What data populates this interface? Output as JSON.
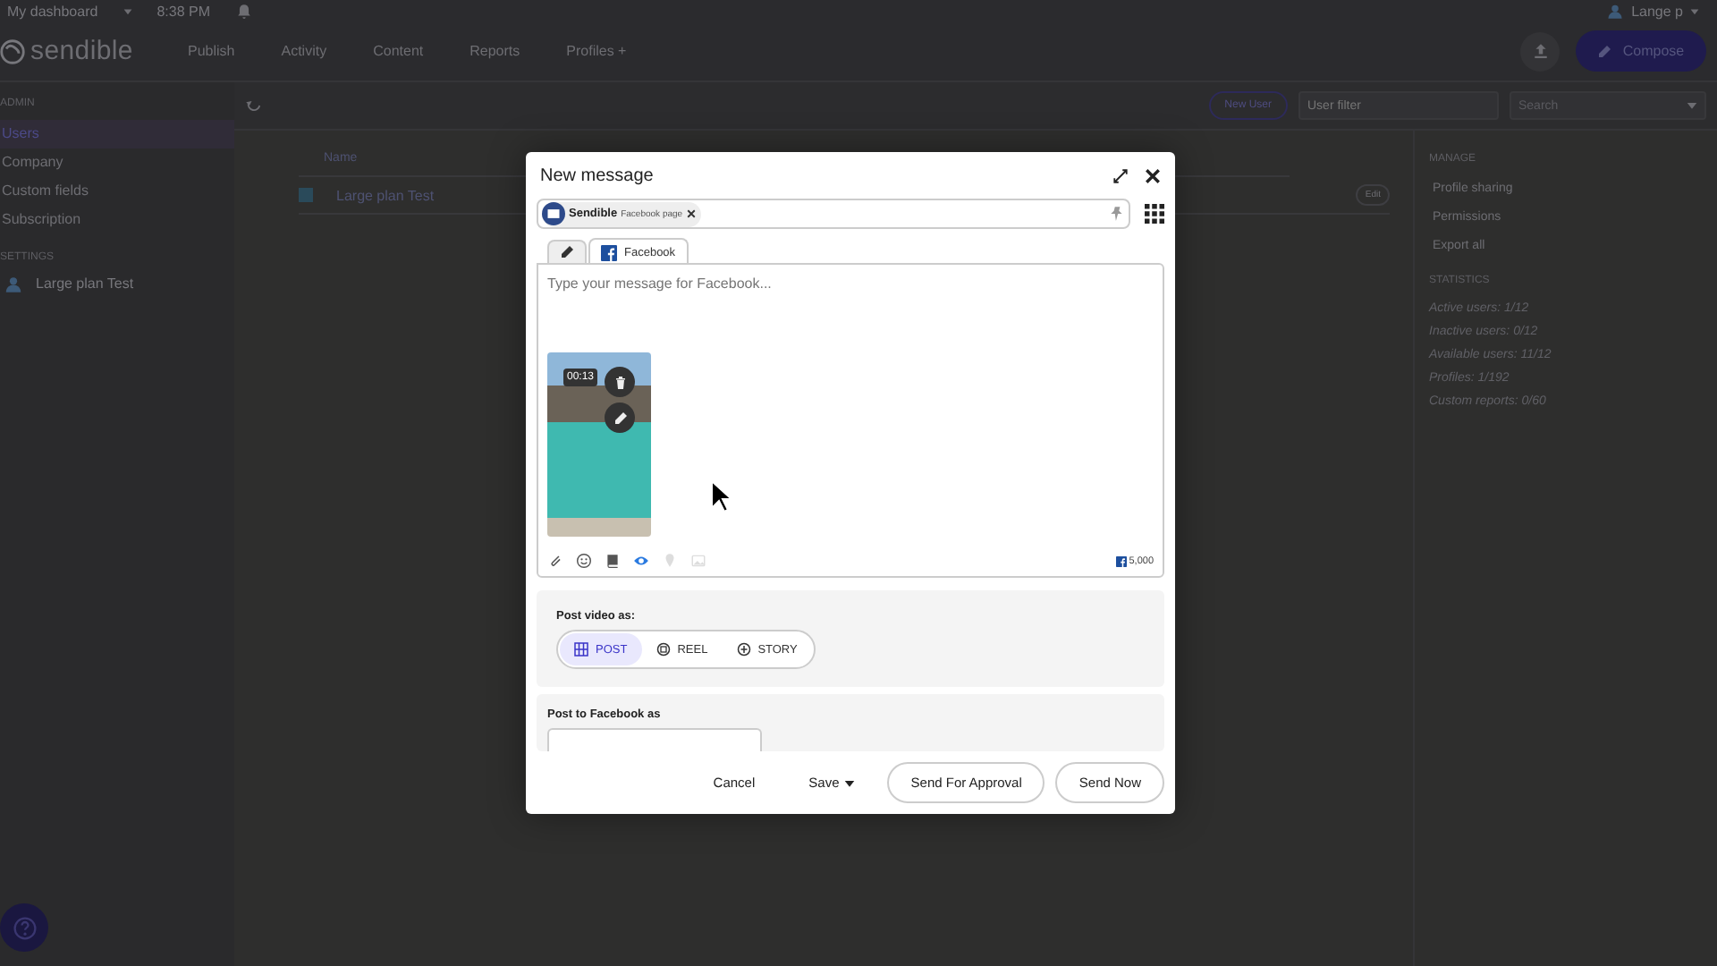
{
  "top_bar": {
    "dashboard": "My dashboard",
    "time": "8:38 PM",
    "user": "Lange p"
  },
  "nav": {
    "logo": "sendible",
    "items": [
      {
        "label": "Publish"
      },
      {
        "label": "Activity"
      },
      {
        "label": "Content"
      },
      {
        "label": "Reports"
      },
      {
        "label": "Profiles +"
      }
    ],
    "compose": "Compose"
  },
  "sidebar": {
    "admin_heading": "ADMIN",
    "items": [
      {
        "label": "Users",
        "selected": true
      },
      {
        "label": "Company",
        "selected": false
      },
      {
        "label": "Custom fields",
        "selected": false
      },
      {
        "label": "Subscription",
        "selected": false
      }
    ],
    "settings_heading": "SETTINGS",
    "account": "Large plan Test"
  },
  "toolbar": {
    "new_user": "New User",
    "filter_placeholder": "User filter",
    "search_placeholder": "Search"
  },
  "table": {
    "columns": [
      "Name"
    ],
    "rows": [
      {
        "name": "Large plan Test",
        "checked": true,
        "action": "Edit"
      }
    ]
  },
  "manage": {
    "heading": "MANAGE",
    "links": [
      "Profile sharing",
      "Permissions",
      "Export all"
    ]
  },
  "statistics": {
    "heading": "STATISTICS",
    "lines": [
      "Active users: 1/12",
      "Inactive users: 0/12",
      "Available users: 11/12",
      "Profiles: 1/192",
      "Custom reports: 0/60"
    ]
  },
  "modal": {
    "title": "New message",
    "profile": {
      "name": "Sendible",
      "type": "Facebook page"
    },
    "tabs": [
      {
        "kind": "pencil",
        "selected": false
      },
      {
        "kind": "facebook",
        "label": "Facebook",
        "selected": true
      }
    ],
    "message": {
      "placeholder": "Type your message for Facebook..."
    },
    "video": {
      "duration": "00:13"
    },
    "tools": [
      {
        "active": false,
        "disabled": false
      },
      {
        "active": false,
        "disabled": false
      },
      {
        "active": false,
        "disabled": false
      },
      {
        "active": true,
        "disabled": false
      },
      {
        "active": false,
        "disabled": true
      },
      {
        "active": false,
        "disabled": true
      }
    ],
    "char_limit": "5,000",
    "post_video_as": {
      "label": "Post video as:",
      "options": [
        {
          "kind": "post",
          "label": "POST",
          "selected": true
        },
        {
          "kind": "reel",
          "label": "REEL",
          "selected": false
        },
        {
          "kind": "story",
          "label": "STORY",
          "selected": false
        }
      ]
    },
    "post_as": {
      "label": "Post to Facebook as"
    },
    "buttons": {
      "cancel": "Cancel",
      "save": "Save",
      "approval": "Send For Approval",
      "send": "Send Now"
    }
  }
}
